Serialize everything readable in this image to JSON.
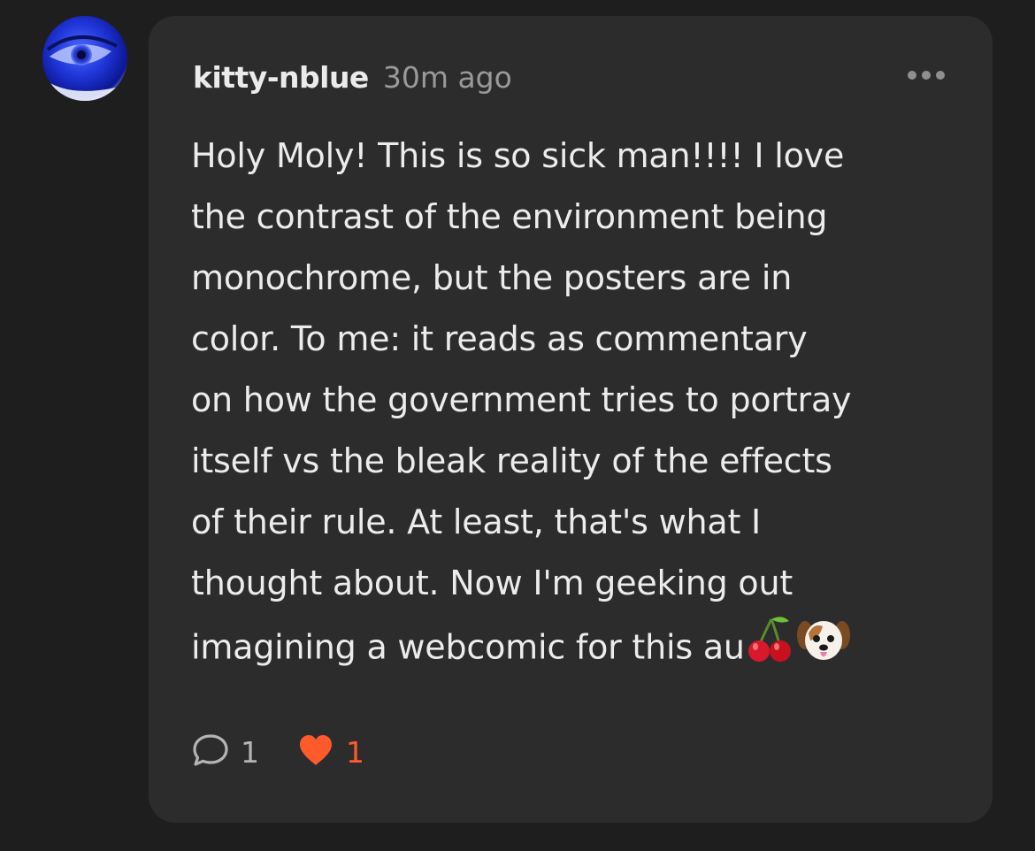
{
  "comment": {
    "username": "kitty-nblue",
    "timestamp": "30m ago",
    "body_lines": [
      "Holy Moly! This is so sick man!!!! I love",
      "the contrast of the environment being",
      "monochrome, but the posters are in",
      "color. To me: it reads as commentary",
      "on how the government tries to portray",
      "itself vs the bleak reality of the effects",
      "of their rule. At least, that's what I",
      "thought about. Now I'm geeking out",
      "imagining  a webcomic for this au"
    ],
    "emojis": [
      "cherries-icon",
      "dog-face-icon"
    ],
    "reply_count": "1",
    "like_count": "1"
  },
  "icons": {
    "avatar": "avatar-eye-image",
    "more": "more-options-icon",
    "reply": "comment-bubble-icon",
    "like": "heart-icon"
  },
  "colors": {
    "background": "#1e1e1f",
    "card": "#2c2c2d",
    "text": "#ececec",
    "muted": "#9a9a9c",
    "like_accent": "#ff5a2c"
  }
}
